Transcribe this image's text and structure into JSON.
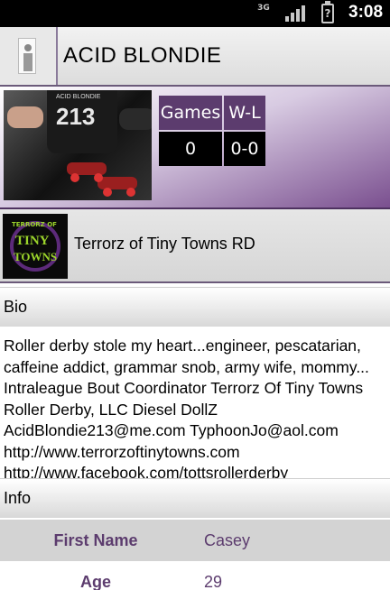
{
  "status_bar": {
    "network": "3G",
    "time": "3:08"
  },
  "header": {
    "title": "ACID BLONDIE"
  },
  "profile": {
    "photo_number": "213",
    "photo_tag": "ACID BLONDIE",
    "stats": {
      "games_label": "Games",
      "wl_label": "W-L",
      "games_value": "0",
      "wl_value": "0-0"
    }
  },
  "team": {
    "name": "Terrorz of Tiny Towns RD",
    "logo_line1": "TINY",
    "logo_line2": "TOWNS",
    "logo_top": "TERRORZ OF"
  },
  "bio": {
    "header": "Bio",
    "text": "Roller derby stole my heart...engineer, pescatarian, caffeine addict, grammar snob, army wife, mommy... Intraleague Bout Coordinator Terrorz Of Tiny Towns Roller Derby, LLC Diesel DollZ AcidBlondie213@me.com TyphoonJo@aol.com http://www.terrorzoftinytowns.com http://www.facebook.com/tottsrollerderby"
  },
  "info": {
    "header": "Info",
    "rows": [
      {
        "label": "First Name",
        "value": "Casey"
      },
      {
        "label": "Age",
        "value": "29"
      }
    ]
  },
  "colors": {
    "accent": "#5c3c6e",
    "stat_value_bg": "#000000"
  }
}
